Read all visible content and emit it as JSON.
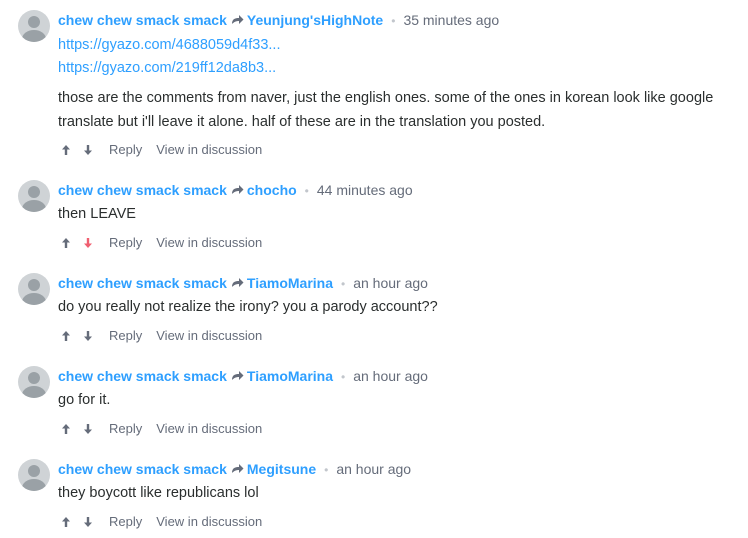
{
  "comments": [
    {
      "author": "chew chew smack smack",
      "reply_to": "Yeunjung'sHighNote",
      "time": "35 minutes ago",
      "links": [
        "https://gyazo.com/4688059d4f33...",
        "https://gyazo.com/219ff12da8b3..."
      ],
      "body_lines": [
        "those are the comments from naver, just the english ones. some of the ones in korean look like google",
        "translate but i'll leave it alone. half of these are in the translation you posted."
      ],
      "reply_label": "Reply",
      "view_label": "View in discussion",
      "downvoted": false
    },
    {
      "author": "chew chew smack smack",
      "reply_to": "chocho",
      "time": "44 minutes ago",
      "body_lines": [
        "then LEAVE"
      ],
      "reply_label": "Reply",
      "view_label": "View in discussion",
      "downvoted": true
    },
    {
      "author": "chew chew smack smack",
      "reply_to": "TiamoMarina",
      "time": "an hour ago",
      "body_lines": [
        "do you really not realize the irony? you a parody account??"
      ],
      "reply_label": "Reply",
      "view_label": "View in discussion",
      "downvoted": false
    },
    {
      "author": "chew chew smack smack",
      "reply_to": "TiamoMarina",
      "time": "an hour ago",
      "body_lines": [
        "go for it."
      ],
      "reply_label": "Reply",
      "view_label": "View in discussion",
      "downvoted": false
    },
    {
      "author": "chew chew smack smack",
      "reply_to": "Megitsune",
      "time": "an hour ago",
      "body_lines": [
        "they boycott like republicans lol"
      ],
      "reply_label": "Reply",
      "view_label": "View in discussion",
      "downvoted": false
    }
  ],
  "colors": {
    "link": "#2e9fff",
    "meta": "#656c7a",
    "downvote_active": "#f05f70",
    "vote_default": "#656c7a"
  },
  "icons": {
    "reply_arrow": "share-arrow-icon",
    "upvote": "arrow-up-icon",
    "downvote": "arrow-down-icon",
    "avatar": "default-avatar-icon"
  }
}
